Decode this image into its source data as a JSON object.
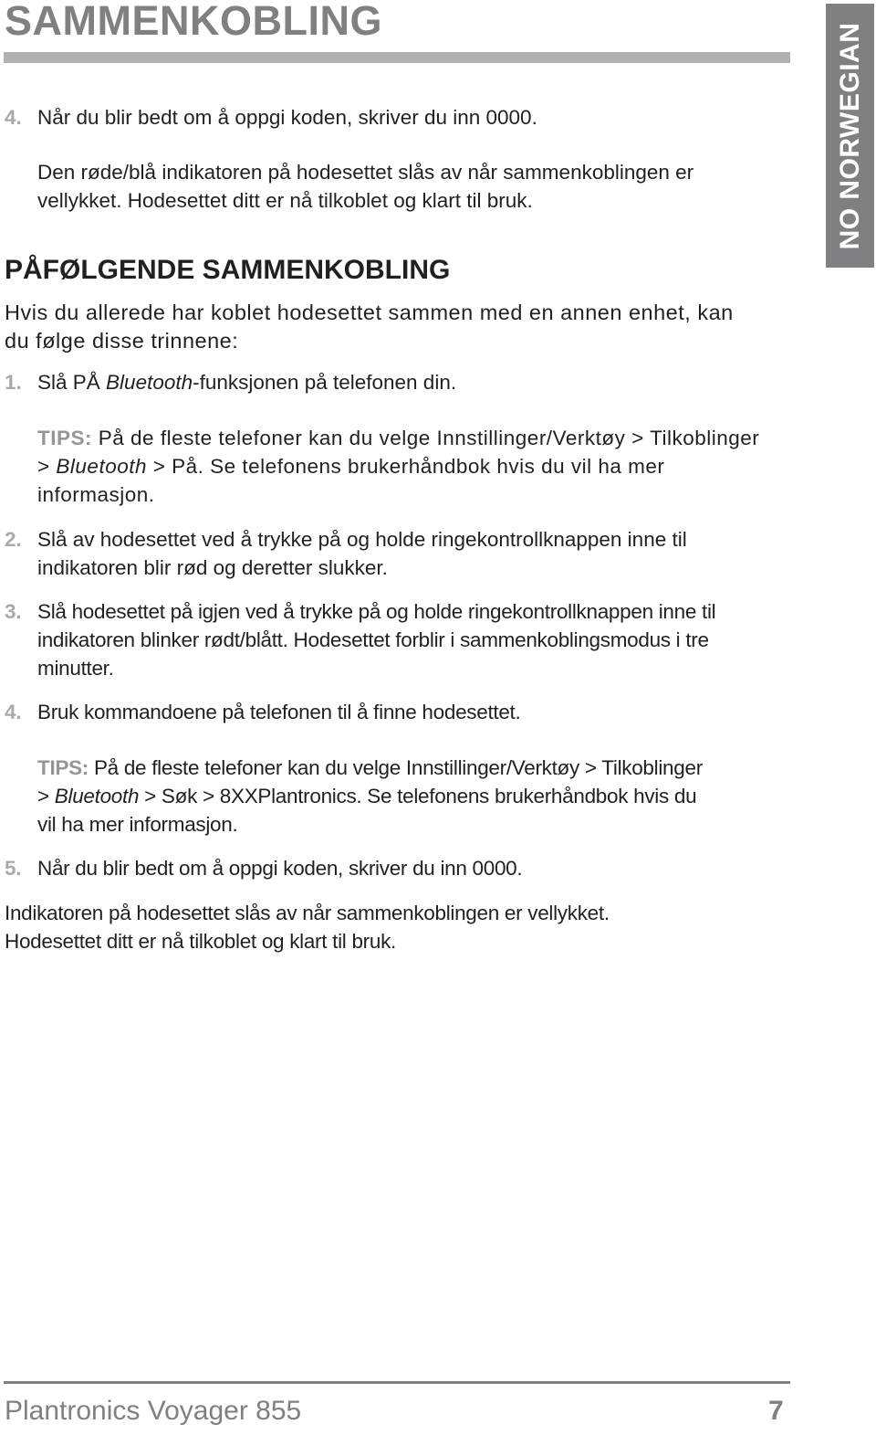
{
  "header": {
    "title": "SAMMENKOBLING",
    "language_tab": "NO NORWEGIAN"
  },
  "first_section": {
    "step4": {
      "number": "4.",
      "text": "Når du blir bedt om å oppgi koden, skriver du inn 0000."
    },
    "result_line1": "Den røde/blå indikatoren på hodesettet slås av når sammenkoblingen er",
    "result_line2": "vellykket. Hodesettet ditt er nå tilkoblet og klart til bruk."
  },
  "subsequent_section": {
    "heading": "PÅFØLGENDE SAMMENKOBLING",
    "intro_line1": "Hvis du allerede har koblet hodesettet sammen med en annen enhet, kan",
    "intro_line2": "du følge disse trinnene:",
    "step1": {
      "number": "1.",
      "text_pre": "Slå PÅ ",
      "text_italic": "Bluetooth",
      "text_post": "-funksjonen på telefonen din."
    },
    "tips1": {
      "label": "TIPS:",
      "line1": " På de fleste telefoner kan du velge Innstillinger/Verktøy > Tilkoblinger",
      "line2_pre": "> ",
      "line2_italic": "Bluetooth",
      "line2_post": " > På. Se telefonens brukerhåndbok hvis du vil ha mer",
      "line3": "informasjon."
    },
    "step2": {
      "number": "2.",
      "line1": "Slå av hodesettet ved å trykke på og holde ringekontrollknappen inne til",
      "line2": "indikatoren blir rød og deretter slukker."
    },
    "step3": {
      "number": "3.",
      "line1": "Slå hodesettet på igjen ved å trykke på og holde ringekontrollknappen inne til",
      "line2": "indikatoren blinker rødt/blått. Hodesettet forblir i sammenkoblingsmodus i tre",
      "line3": "minutter."
    },
    "step4": {
      "number": "4.",
      "text": "Bruk kommandoene på telefonen til å finne hodesettet."
    },
    "tips2": {
      "label": "TIPS:",
      "line1": " På de fleste telefoner kan du velge Innstillinger/Verktøy > Tilkoblinger",
      "line2_pre": "> ",
      "line2_italic": "Bluetooth",
      "line2_post": " > Søk > 8XXPlantronics. Se telefonens brukerhåndbok hvis du",
      "line3": "vil ha mer informasjon."
    },
    "step5": {
      "number": "5.",
      "text": "Når du blir bedt om å oppgi koden, skriver du inn 0000."
    },
    "result_line1": "Indikatoren på hodesettet slås av når sammenkoblingen er vellykket.",
    "result_line2": "Hodesettet ditt er nå tilkoblet og klart til bruk."
  },
  "footer": {
    "product": "Plantronics Voyager 855",
    "page_number": "7"
  },
  "colors": {
    "heading_gray": "#808082",
    "rule_gray": "#b1b1b3",
    "number_gray": "#a7a9ac",
    "text": "#231f20"
  }
}
